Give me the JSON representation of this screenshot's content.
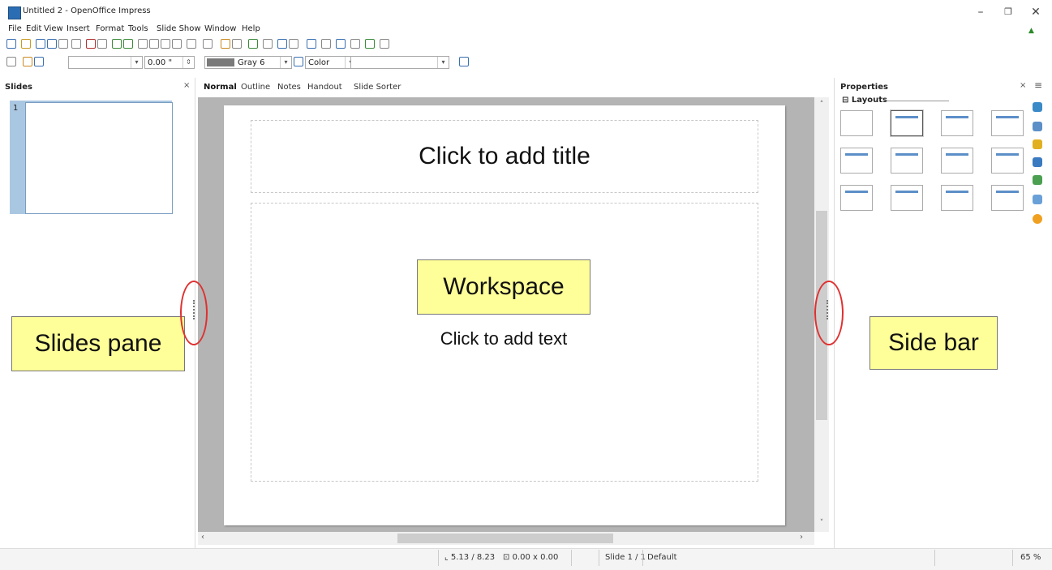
{
  "window": {
    "title": "Untitled 2 - OpenOffice Impress",
    "minimize": "–",
    "restore": "❐",
    "close": "✕"
  },
  "menu": [
    "File",
    "Edit",
    "View",
    "Insert",
    "Format",
    "Tools",
    "Slide Show",
    "Window",
    "Help"
  ],
  "toolbar2": {
    "line_width": "0.00 \"",
    "color_name": "Gray 6",
    "fill_type": "Color",
    "gray_swatch": "#7a7a7a"
  },
  "slides_pane": {
    "title": "Slides",
    "close": "×",
    "slide_number": "1"
  },
  "view_tabs": [
    "Normal",
    "Outline",
    "Notes",
    "Handout",
    "Slide Sorter"
  ],
  "slide": {
    "title_placeholder": "Click to add title",
    "content_placeholder": "Click to add text"
  },
  "sidebar": {
    "title": "Properties",
    "close": "×",
    "menu_icon": "≡",
    "section": "Layouts",
    "layout_count": 12
  },
  "status": {
    "position": "5.13 / 8.23",
    "size": "0.00 x 0.00",
    "slide": "Slide 1 / 1",
    "master": "Default",
    "zoom": "65 %"
  },
  "annotations": {
    "slides_pane": "Slides pane",
    "workspace": "Workspace",
    "side_bar": "Side bar"
  },
  "colors": {
    "callout_fill": "#ffff99",
    "ring": "#e03030",
    "thumb_selected": "#aac7e2",
    "workspace_bg": "#b4b4b4"
  }
}
